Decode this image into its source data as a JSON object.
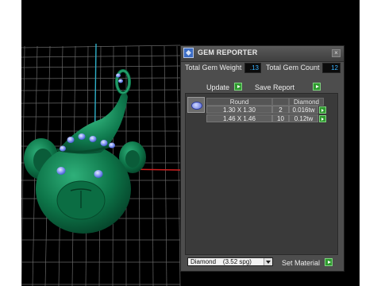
{
  "panel": {
    "title": "GEM REPORTER",
    "close_glyph": "×",
    "total_weight_label": "Total Gem Weight",
    "total_weight_value": ".13",
    "total_count_label": "Total Gem Count",
    "total_count_value": "12",
    "update_label": "Update",
    "save_report_label": "Save Report"
  },
  "table": {
    "headers": [
      "Round",
      "",
      "Diamond"
    ],
    "rows": [
      {
        "size": "1.30 X 1.30",
        "count": "2",
        "weight": "0.016tw"
      },
      {
        "size": "1.46 X 1.46",
        "count": "10",
        "weight": "0.12tw"
      }
    ]
  },
  "material": {
    "selected": "Diamond    (3.52 spg)",
    "set_label": "Set Material"
  },
  "icons": {
    "app": "gem-reporter-icon",
    "gem": "round-gem-icon",
    "go": "green-play-icon",
    "dropdown": "chevron-down-icon"
  },
  "colors": {
    "panel_bg": "#4d4d4d",
    "value_text": "#39b3ff",
    "go_button": "#2f9a2f",
    "model": "#0f7a4e",
    "gem_blue": "#7a8ff0"
  }
}
